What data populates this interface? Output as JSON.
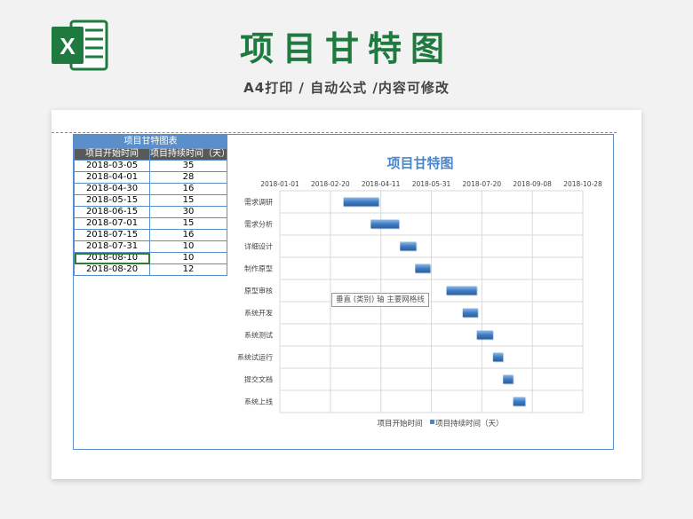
{
  "header": {
    "title": "项目甘特图",
    "subtitle": "A4打印 / 自动公式 /内容可修改",
    "logo_letter": "X"
  },
  "table": {
    "caption": "项目甘特图表",
    "col_start": "项目开始时间",
    "col_duration": "项目持续时间（天）",
    "rows": [
      {
        "start": "2018-03-05",
        "days": "35"
      },
      {
        "start": "2018-04-01",
        "days": "28"
      },
      {
        "start": "2018-04-30",
        "days": "16"
      },
      {
        "start": "2018-05-15",
        "days": "15"
      },
      {
        "start": "2018-06-15",
        "days": "30"
      },
      {
        "start": "2018-07-01",
        "days": "15"
      },
      {
        "start": "2018-07-15",
        "days": "16"
      },
      {
        "start": "2018-07-31",
        "days": "10"
      },
      {
        "start": "2018-08-10",
        "days": "10"
      },
      {
        "start": "2018-08-20",
        "days": "12"
      }
    ]
  },
  "tooltip": "垂直 (类别) 轴 主要网格线",
  "chart_data": {
    "type": "bar",
    "orientation": "horizontal-stacked-gantt",
    "title": "项目甘特图",
    "categories": [
      "需求调研",
      "需求分析",
      "详细设计",
      "制作原型",
      "原型审核",
      "系统开发",
      "系统测试",
      "系统试运行",
      "提交文档",
      "系统上线"
    ],
    "x_ticks": [
      "2018-01-01",
      "2018-02-20",
      "2018-04-11",
      "2018-05-31",
      "2018-07-20",
      "2018-09-08",
      "2018-10-28"
    ],
    "xlim": [
      "2018-01-01",
      "2018-10-28"
    ],
    "series": [
      {
        "name": "项目开始时间",
        "values": [
          "2018-03-05",
          "2018-04-01",
          "2018-04-30",
          "2018-05-15",
          "2018-06-15",
          "2018-07-01",
          "2018-07-15",
          "2018-07-31",
          "2018-08-10",
          "2018-08-20"
        ],
        "visible": false
      },
      {
        "name": "项目持续时间（天）",
        "values": [
          35,
          28,
          16,
          15,
          30,
          15,
          16,
          10,
          10,
          12
        ],
        "color": "#4a86c8"
      }
    ],
    "legend_position": "bottom",
    "grid": true
  }
}
